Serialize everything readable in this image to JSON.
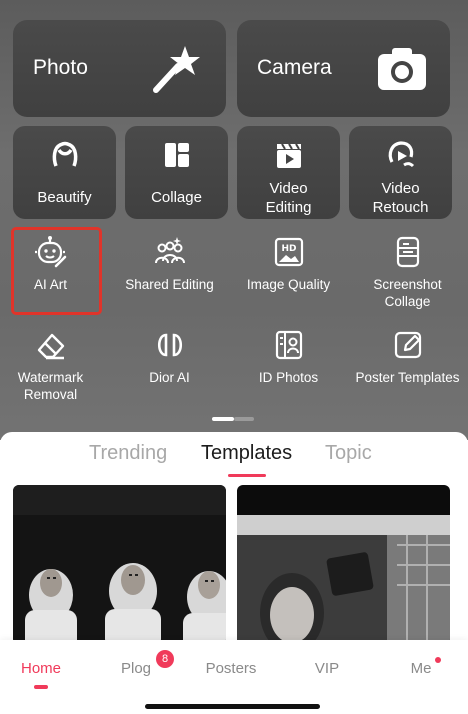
{
  "top_cards": {
    "photo": "Photo",
    "camera": "Camera"
  },
  "mid_cards": {
    "beautify": "Beautify",
    "collage": "Collage",
    "video_editing_1": "Video",
    "video_editing_2": "Editing",
    "video_retouch_1": "Video",
    "video_retouch_2": "Retouch"
  },
  "tools": {
    "ai_art": "AI Art",
    "shared_editing": "Shared Editing",
    "image_quality": "Image Quality",
    "screenshot_collage_1": "Screenshot",
    "screenshot_collage_2": "Collage",
    "watermark_removal_1": "Watermark",
    "watermark_removal_2": "Removal",
    "dior_ai": "Dior AI",
    "id_photos": "ID Photos",
    "poster_templates": "Poster Templates"
  },
  "tabs": [
    "Trending",
    "Templates",
    "Topic"
  ],
  "nav": {
    "home": "Home",
    "plog": "Plog",
    "plog_badge": "8",
    "posters": "Posters",
    "vip": "VIP",
    "me": "Me"
  },
  "colors": {
    "accent": "#f03a5a",
    "highlight_box": "#e0342a",
    "card_bg": "#444444"
  }
}
